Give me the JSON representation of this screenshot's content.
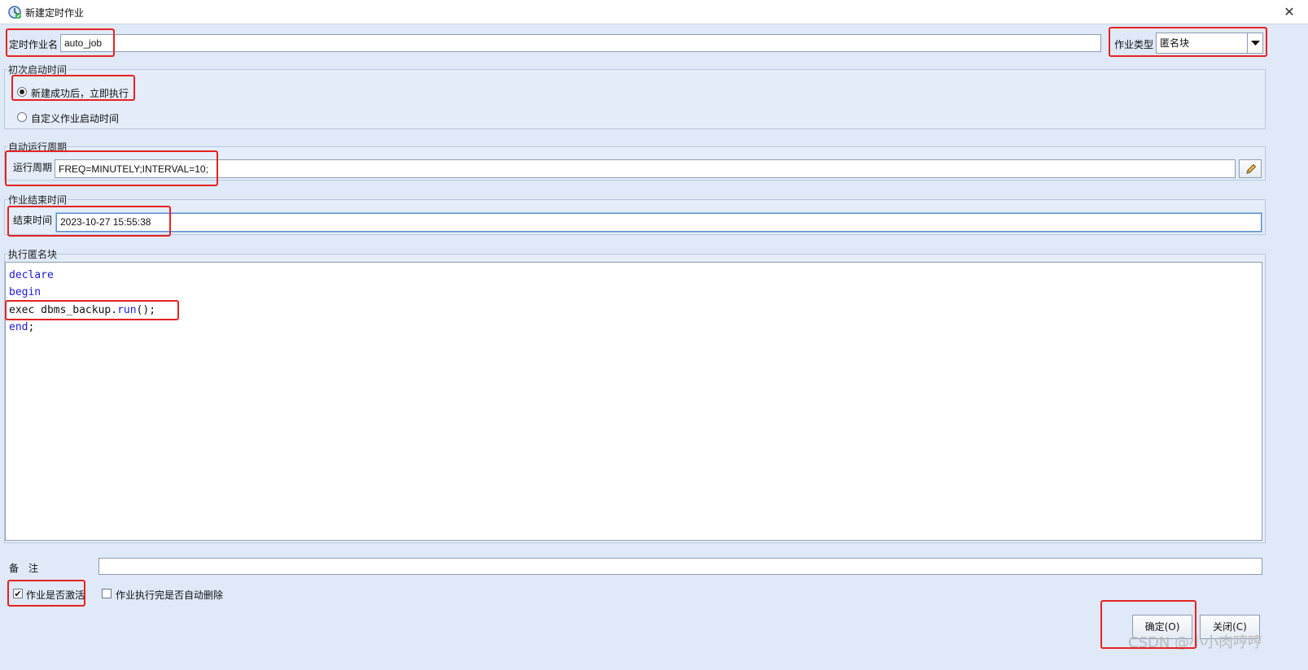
{
  "window": {
    "title": "新建定时作业",
    "close_icon": "✕"
  },
  "job_name": {
    "label": "定时作业名",
    "value": "auto_job"
  },
  "job_type": {
    "label": "作业类型",
    "value": "匿名块"
  },
  "first_start": {
    "group_title": "初次启动时间",
    "option_immediate": "新建成功后，立即执行",
    "option_custom": "自定义作业启动时间"
  },
  "auto_run": {
    "group_title": "自动运行周期",
    "label": "运行周期",
    "value": "FREQ=MINUTELY;INTERVAL=10;"
  },
  "end_time": {
    "group_title": "作业结束时间",
    "label": "结束时间",
    "value": "2023-10-27 15:55:38"
  },
  "anon_block": {
    "group_title": "执行匿名块",
    "line1": "declare",
    "line2": "begin",
    "line3_prefix": "exec dbms_backup.",
    "line3_fn": "run",
    "line3_suffix": "();",
    "line4_kw": "end",
    "line4_suffix": ";"
  },
  "remark": {
    "label": "备　注",
    "value": ""
  },
  "active": {
    "label": "作业是否激活",
    "checked": true,
    "mark": "✔"
  },
  "auto_delete": {
    "label": "作业执行完是否自动删除",
    "checked": false
  },
  "buttons": {
    "ok": "确定(O)",
    "close": "关闭(C)"
  },
  "watermark": "CSDN @小小肉哼哼",
  "colors": {
    "highlight": "#e52222",
    "keyword": "#1a1ad8",
    "background": "#dfe9f7"
  }
}
